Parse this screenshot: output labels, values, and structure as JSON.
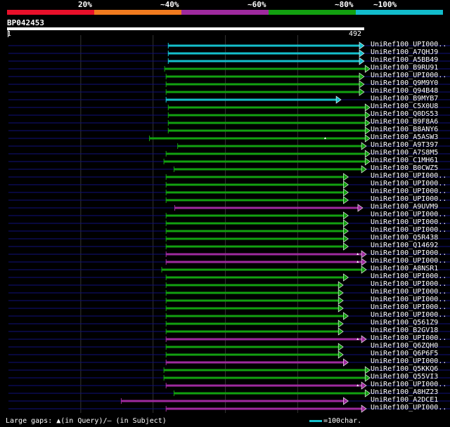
{
  "legend": {
    "segments": [
      {
        "color": "#e8102a",
        "label": ""
      },
      {
        "color": "#ef7a1e",
        "label": "20%"
      },
      {
        "color": "#9e2a9e",
        "label": "~40%"
      },
      {
        "color": "#12a010",
        "label": "~60%"
      },
      {
        "color": "#12bccc",
        "label": "~80%"
      },
      {
        "color": "#12bccc",
        "label": "~100%"
      }
    ]
  },
  "query": {
    "id": "BP042453",
    "start_label": "1",
    "end_label": "492"
  },
  "footer": {
    "gaps_text": "Large gaps: ▲(in Query)/— (in Subject)",
    "scale_text": "=100char."
  },
  "chart_data": {
    "type": "alignment-overview",
    "query_length": 492,
    "colors": {
      "cyan": "#14bfcc",
      "green": "#12a010",
      "purple": "#9e2a9e",
      "dim": "#10107a"
    },
    "hits": [
      {
        "name": "UniRef100_UPI000..",
        "start": 221,
        "end": 492,
        "color": "cyan",
        "gap_marks": []
      },
      {
        "name": "UniRef100_A7QHJ9",
        "start": 221,
        "end": 492,
        "color": "cyan",
        "gap_marks": []
      },
      {
        "name": "UniRef100_A5BB49",
        "start": 221,
        "end": 492,
        "color": "cyan",
        "gap_marks": []
      },
      {
        "name": "UniRef100_B9RU91",
        "start": 216,
        "end": 500,
        "color": "green",
        "gap_marks": []
      },
      {
        "name": "UniRef100_UPI000..",
        "start": 218,
        "end": 492,
        "color": "green",
        "gap_marks": []
      },
      {
        "name": "UniRef100_Q9M9Y0",
        "start": 218,
        "end": 492,
        "color": "green",
        "gap_marks": []
      },
      {
        "name": "UniRef100_Q94B48",
        "start": 218,
        "end": 492,
        "color": "green",
        "gap_marks": []
      },
      {
        "name": "UniRef100_B9MYB7",
        "start": 218,
        "end": 460,
        "color": "cyan",
        "gap_marks": []
      },
      {
        "name": "UniRef100_C5X0U8",
        "start": 221,
        "end": 500,
        "color": "green",
        "gap_marks": []
      },
      {
        "name": "UniRef100_Q0DS53",
        "start": 221,
        "end": 500,
        "color": "green",
        "gap_marks": []
      },
      {
        "name": "UniRef100_B9F8A6",
        "start": 221,
        "end": 500,
        "color": "green",
        "gap_marks": []
      },
      {
        "name": "UniRef100_B8ANY6",
        "start": 221,
        "end": 500,
        "color": "green",
        "gap_marks": []
      },
      {
        "name": "UniRef100_A5ASW3",
        "start": 195,
        "end": 500,
        "color": "green",
        "gap_marks": [
          438
        ]
      },
      {
        "name": "UniRef100_A9T397",
        "start": 234,
        "end": 495,
        "color": "green",
        "gap_marks": []
      },
      {
        "name": "UniRef100_A7S8M5",
        "start": 218,
        "end": 500,
        "color": "green",
        "gap_marks": []
      },
      {
        "name": "UniRef100_C1MH61",
        "start": 215,
        "end": 500,
        "color": "green",
        "gap_marks": []
      },
      {
        "name": "UniRef100_B0CWZ5",
        "start": 229,
        "end": 495,
        "color": "green",
        "gap_marks": []
      },
      {
        "name": "UniRef100_UPI000..",
        "start": 218,
        "end": 470,
        "color": "green",
        "gap_marks": []
      },
      {
        "name": "UniRef100_UPI000..",
        "start": 218,
        "end": 470,
        "color": "green",
        "gap_marks": []
      },
      {
        "name": "UniRef100_UPI000..",
        "start": 218,
        "end": 470,
        "color": "green",
        "gap_marks": []
      },
      {
        "name": "UniRef100_UPI000..",
        "start": 218,
        "end": 470,
        "color": "green",
        "gap_marks": []
      },
      {
        "name": "UniRef100_A9UVM9",
        "start": 230,
        "end": 490,
        "color": "purple",
        "gap_marks": []
      },
      {
        "name": "UniRef100_UPI000..",
        "start": 218,
        "end": 470,
        "color": "green",
        "gap_marks": []
      },
      {
        "name": "UniRef100_UPI000..",
        "start": 218,
        "end": 470,
        "color": "green",
        "gap_marks": []
      },
      {
        "name": "UniRef100_UPI000..",
        "start": 218,
        "end": 470,
        "color": "green",
        "gap_marks": []
      },
      {
        "name": "UniRef100_Q5R438",
        "start": 218,
        "end": 470,
        "color": "green",
        "gap_marks": []
      },
      {
        "name": "UniRef100_Q14692",
        "start": 218,
        "end": 470,
        "color": "green",
        "gap_marks": []
      },
      {
        "name": "UniRef100_UPI000..",
        "start": 218,
        "end": 495,
        "color": "purple",
        "gap_marks": [
          483
        ]
      },
      {
        "name": "UniRef100_UPI000..",
        "start": 218,
        "end": 495,
        "color": "purple",
        "gap_marks": [
          483
        ]
      },
      {
        "name": "UniRef100_A8NSR1",
        "start": 212,
        "end": 495,
        "color": "green",
        "gap_marks": []
      },
      {
        "name": "UniRef100_UPI000..",
        "start": 218,
        "end": 470,
        "color": "green",
        "gap_marks": []
      },
      {
        "name": "UniRef100_UPI000..",
        "start": 218,
        "end": 463,
        "color": "green",
        "gap_marks": []
      },
      {
        "name": "UniRef100_UPI000..",
        "start": 218,
        "end": 463,
        "color": "green",
        "gap_marks": []
      },
      {
        "name": "UniRef100_UPI000..",
        "start": 218,
        "end": 463,
        "color": "green",
        "gap_marks": []
      },
      {
        "name": "UniRef100_UPI000..",
        "start": 218,
        "end": 463,
        "color": "green",
        "gap_marks": []
      },
      {
        "name": "UniRef100_UPI000..",
        "start": 218,
        "end": 470,
        "color": "green",
        "gap_marks": []
      },
      {
        "name": "UniRef100_Q561Z9",
        "start": 218,
        "end": 463,
        "color": "green",
        "gap_marks": []
      },
      {
        "name": "UniRef100_B2GV18",
        "start": 218,
        "end": 463,
        "color": "green",
        "gap_marks": []
      },
      {
        "name": "UniRef100_UPI000..",
        "start": 218,
        "end": 495,
        "color": "purple",
        "gap_marks": [
          483
        ]
      },
      {
        "name": "UniRef100_Q6ZQH0",
        "start": 218,
        "end": 463,
        "color": "green",
        "gap_marks": []
      },
      {
        "name": "UniRef100_Q6P6F5",
        "start": 218,
        "end": 463,
        "color": "green",
        "gap_marks": []
      },
      {
        "name": "UniRef100_UPI000..",
        "start": 218,
        "end": 470,
        "color": "purple",
        "gap_marks": []
      },
      {
        "name": "UniRef100_Q5KKQ6",
        "start": 215,
        "end": 500,
        "color": "green",
        "gap_marks": []
      },
      {
        "name": "UniRef100_Q55VI3",
        "start": 215,
        "end": 500,
        "color": "green",
        "gap_marks": []
      },
      {
        "name": "UniRef100_UPI000..",
        "start": 218,
        "end": 495,
        "color": "purple",
        "gap_marks": [
          483
        ]
      },
      {
        "name": "UniRef100_A8HZ23",
        "start": 229,
        "end": 500,
        "color": "green",
        "gap_marks": []
      },
      {
        "name": "UniRef100_A2DCE1",
        "start": 156,
        "end": 470,
        "color": "purple",
        "gap_marks": []
      },
      {
        "name": "UniRef100_UPI000..",
        "start": 218,
        "end": 495,
        "color": "purple",
        "gap_marks": []
      }
    ]
  }
}
